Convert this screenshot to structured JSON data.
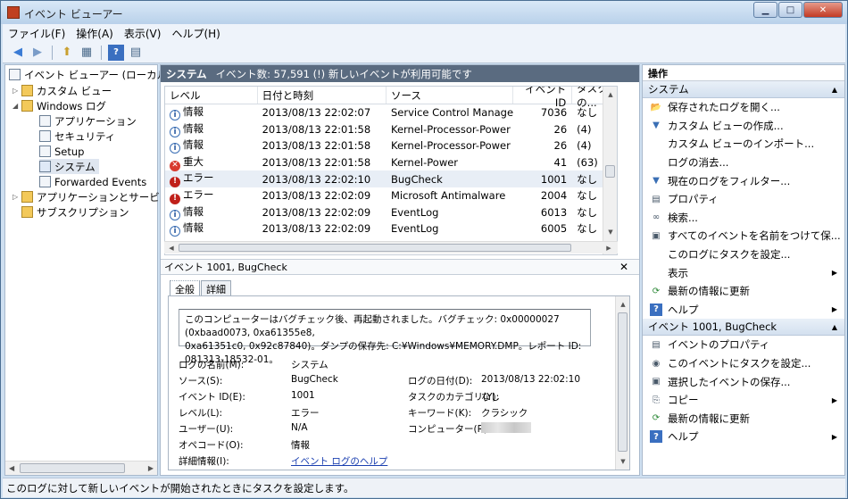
{
  "window": {
    "title": "イベント ビューアー"
  },
  "menu": [
    "ファイル(F)",
    "操作(A)",
    "表示(V)",
    "ヘルプ(H)"
  ],
  "tree": [
    {
      "label": "イベント ビューアー (ローカル",
      "level": 0
    },
    {
      "label": "カスタム ビュー",
      "level": 1
    },
    {
      "label": "Windows ログ",
      "level": 1
    },
    {
      "label": "アプリケーション",
      "level": 2
    },
    {
      "label": "セキュリティ",
      "level": 2
    },
    {
      "label": "Setup",
      "level": 2
    },
    {
      "label": "システム",
      "level": 2
    },
    {
      "label": "Forwarded Events",
      "level": 2
    },
    {
      "label": "アプリケーションとサービス",
      "level": 1
    },
    {
      "label": "サブスクリプション",
      "level": 1
    }
  ],
  "center": {
    "header_name": "システム",
    "header_info": "イベント数: 57,591 (!) 新しいイベントが利用可能です",
    "columns": [
      "レベル",
      "日付と時刻",
      "ソース",
      "イベント ID",
      "タスクの..."
    ],
    "rows": [
      {
        "level": "情報",
        "kind": "info",
        "datetime": "2013/08/13 22:02:07",
        "source": "Service Control Manager",
        "id": "7036",
        "task": "なし"
      },
      {
        "level": "情報",
        "kind": "info",
        "datetime": "2013/08/13 22:01:58",
        "source": "Kernel-Processor-Power",
        "id": "26",
        "task": "(4)"
      },
      {
        "level": "情報",
        "kind": "info",
        "datetime": "2013/08/13 22:01:58",
        "source": "Kernel-Processor-Power",
        "id": "26",
        "task": "(4)"
      },
      {
        "level": "重大",
        "kind": "crit",
        "datetime": "2013/08/13 22:01:58",
        "source": "Kernel-Power",
        "id": "41",
        "task": "(63)"
      },
      {
        "level": "エラー",
        "kind": "err",
        "datetime": "2013/08/13 22:02:10",
        "source": "BugCheck",
        "id": "1001",
        "task": "なし"
      },
      {
        "level": "エラー",
        "kind": "err",
        "datetime": "2013/08/13 22:02:09",
        "source": "Microsoft Antimalware",
        "id": "2004",
        "task": "なし"
      },
      {
        "level": "情報",
        "kind": "info",
        "datetime": "2013/08/13 22:02:09",
        "source": "EventLog",
        "id": "6013",
        "task": "なし"
      },
      {
        "level": "情報",
        "kind": "info",
        "datetime": "2013/08/13 22:02:09",
        "source": "EventLog",
        "id": "6005",
        "task": "なし"
      }
    ]
  },
  "detail": {
    "title": "イベント 1001, BugCheck",
    "tabs": [
      "全般",
      "詳細"
    ],
    "description_line1": "このコンピューターはバグチェック後、再起動されました。バグチェック: 0x00000027 (0xbaad0073, 0xa61355e8,",
    "description_line2": "0xa61351c0, 0x92c87840)。ダンプの保存先: C:¥Windows¥MEMORY.DMP。レポート ID: 081313-18532-01。",
    "labels": {
      "log_name": "ログの名前(M):",
      "source": "ソース(S):",
      "event_id": "イベント ID(E):",
      "level": "レベル(L):",
      "user": "ユーザー(U):",
      "opcode": "オペコード(O):",
      "more_info": "詳細情報(I):",
      "logged": "ログの日付(D):",
      "task_category": "タスクのカテゴリ(Y):",
      "keywords": "キーワード(K):",
      "computer": "コンピューター(R):"
    },
    "values": {
      "log_name": "システム",
      "source": "BugCheck",
      "event_id": "1001",
      "level": "エラー",
      "user": "N/A",
      "opcode": "情報",
      "more_info": "イベント ログのヘルプ",
      "logged": "2013/08/13 22:02:10",
      "task_category": "なし",
      "keywords": "クラシック"
    }
  },
  "actions": {
    "title": "操作",
    "section1": "システム",
    "items1": [
      {
        "label": "保存されたログを開く...",
        "icon": "folder-open-icon",
        "sub": false
      },
      {
        "label": "カスタム ビューの作成...",
        "icon": "filter-icon",
        "sub": false
      },
      {
        "label": "カスタム ビューのインポート...",
        "icon": "",
        "sub": false
      },
      {
        "label": "ログの消去...",
        "icon": "",
        "sub": false
      },
      {
        "label": "現在のログをフィルター...",
        "icon": "filter-icon",
        "sub": false
      },
      {
        "label": "プロパティ",
        "icon": "properties-icon",
        "sub": false
      },
      {
        "label": "検索...",
        "icon": "binoculars-icon",
        "sub": false
      },
      {
        "label": "すべてのイベントを名前をつけて保...",
        "icon": "save-icon",
        "sub": false
      },
      {
        "label": "このログにタスクを設定...",
        "icon": "",
        "sub": false
      },
      {
        "label": "表示",
        "icon": "",
        "sub": true
      },
      {
        "label": "最新の情報に更新",
        "icon": "refresh-icon",
        "sub": false
      },
      {
        "label": "ヘルプ",
        "icon": "help-icon",
        "sub": true
      }
    ],
    "section2": "イベント 1001, BugCheck",
    "items2": [
      {
        "label": "イベントのプロパティ",
        "icon": "properties-icon",
        "sub": false
      },
      {
        "label": "このイベントにタスクを設定...",
        "icon": "task-icon",
        "sub": false
      },
      {
        "label": "選択したイベントの保存...",
        "icon": "save-icon",
        "sub": false
      },
      {
        "label": "コピー",
        "icon": "copy-icon",
        "sub": true
      },
      {
        "label": "最新の情報に更新",
        "icon": "refresh-icon",
        "sub": false
      },
      {
        "label": "ヘルプ",
        "icon": "help-icon",
        "sub": true
      }
    ]
  },
  "status": "このログに対して新しいイベントが開始されたときにタスクを設定します。",
  "icons": {
    "folder-open-icon": "📂",
    "filter-icon": "▼",
    "properties-icon": "▤",
    "binoculars-icon": "∞",
    "save-icon": "▣",
    "refresh-icon": "⟳",
    "help-icon": "?",
    "task-icon": "◉",
    "copy-icon": "⎘"
  }
}
